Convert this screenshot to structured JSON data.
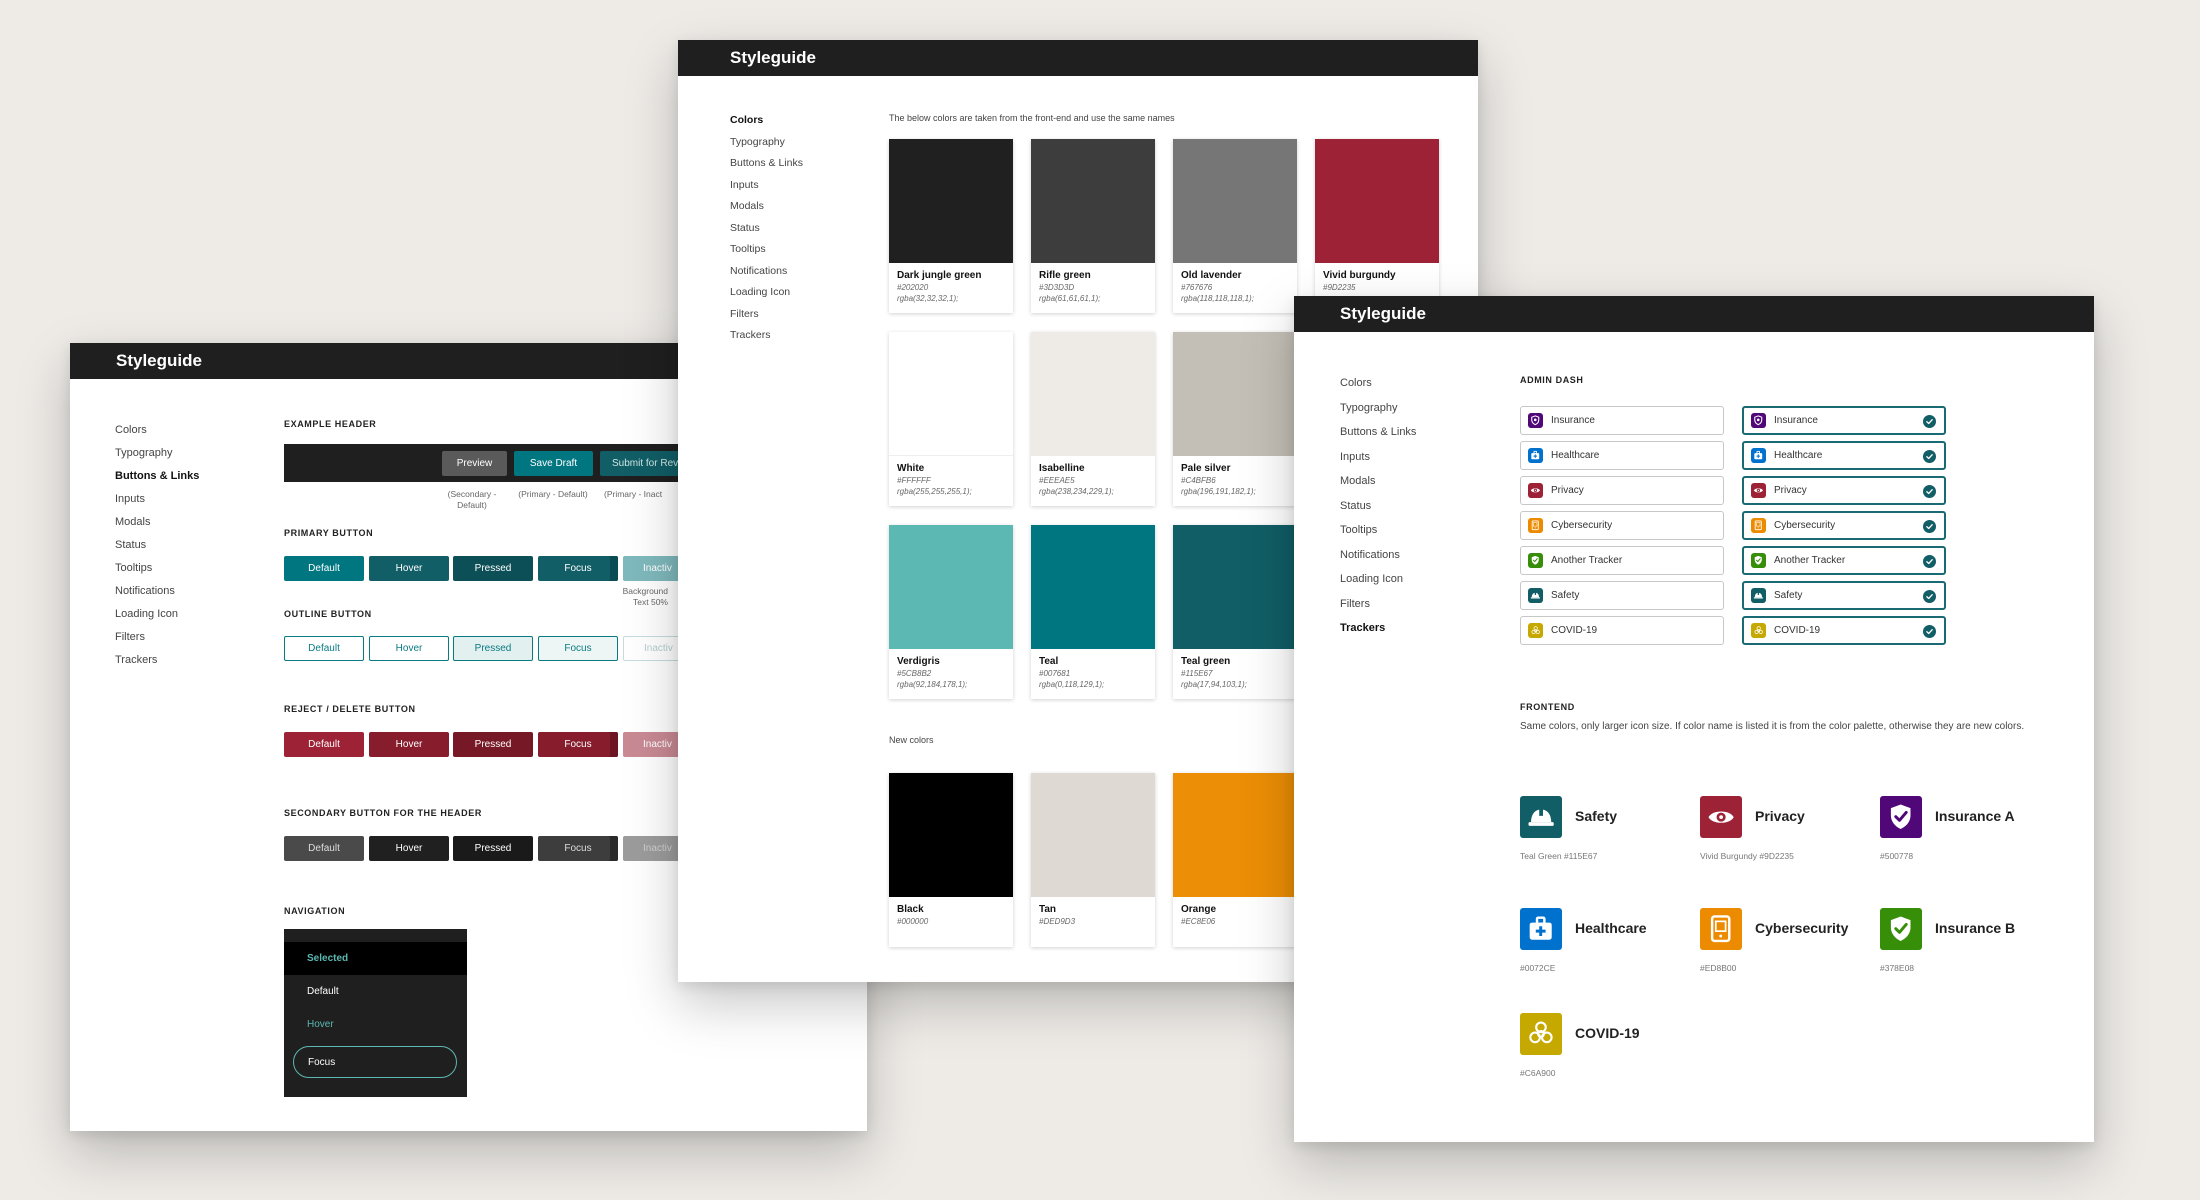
{
  "sheetA": {
    "title": "Styleguide",
    "nav": [
      "Colors",
      "Typography",
      "Buttons & Links",
      "Inputs",
      "Modals",
      "Status",
      "Tooltips",
      "Notifications",
      "Loading Icon",
      "Filters",
      "Trackers"
    ],
    "nav_active_index": 2,
    "example_header": {
      "title": "EXAMPLE HEADER",
      "buttons": [
        "Preview",
        "Save Draft",
        "Submit for Rev"
      ],
      "notes": [
        "(Secondary - Default)",
        "(Primary - Default)",
        "(Primary - Inact"
      ]
    },
    "primary": {
      "title": "PRIMARY BUTTON",
      "labels": [
        "Default",
        "Hover",
        "Pressed",
        "Focus",
        "Inactiv"
      ],
      "note": "Background Text 50%"
    },
    "outline": {
      "title": "OUTLINE BUTTON",
      "labels": [
        "Default",
        "Hover",
        "Pressed",
        "Focus",
        "Inactiv"
      ]
    },
    "reject": {
      "title": "REJECT / DELETE BUTTON",
      "labels": [
        "Default",
        "Hover",
        "Pressed",
        "Focus",
        "Inactiv"
      ]
    },
    "secondary": {
      "title": "SECONDARY BUTTON FOR THE HEADER",
      "labels": [
        "Default",
        "Hover",
        "Pressed",
        "Focus",
        "Inactiv"
      ]
    },
    "navigation": {
      "title": "NAVIGATION",
      "items": [
        "Selected",
        "Default",
        "Hover",
        "Focus"
      ]
    }
  },
  "sheetB": {
    "title": "Styleguide",
    "nav": [
      "Colors",
      "Typography",
      "Buttons & Links",
      "Inputs",
      "Modals",
      "Status",
      "Tooltips",
      "Notifications",
      "Loading Icon",
      "Filters",
      "Trackers"
    ],
    "nav_active_index": 0,
    "intro": "The below colors are taken from the front-end and use the same names",
    "swatches": [
      {
        "name": "Dark jungle green",
        "hex": "#202020",
        "rgba": "rgba(32,32,32,1);",
        "color": "#202020"
      },
      {
        "name": "Rifle green",
        "hex": "#3D3D3D",
        "rgba": "rgba(61,61,61,1);",
        "color": "#3D3D3D"
      },
      {
        "name": "Old lavender",
        "hex": "#767676",
        "rgba": "rgba(118,118,118,1);",
        "color": "#767676"
      },
      {
        "name": "Vivid burgundy",
        "hex": "#9D2235",
        "rgba": "",
        "color": "#9D2235"
      },
      {
        "name": "White",
        "hex": "#FFFFFF",
        "rgba": "rgba(255,255,255,1);",
        "color": "#FFFFFF"
      },
      {
        "name": "Isabelline",
        "hex": "#EEEAE5",
        "rgba": "rgba(238,234,229,1);",
        "color": "#EEEAE5"
      },
      {
        "name": "Pale silver",
        "hex": "#C4BFB6",
        "rgba": "rgba(196,191,182,1);",
        "color": "#C4BFB6"
      },
      {
        "name": "Verdigris",
        "hex": "#5CB8B2",
        "rgba": "rgba(92,184,178,1);",
        "color": "#5CB8B2"
      },
      {
        "name": "Teal",
        "hex": "#007681",
        "rgba": "rgba(0,118,129,1);",
        "color": "#007681"
      },
      {
        "name": "Teal green",
        "hex": "#115E67",
        "rgba": "rgba(17,94,103,1);",
        "color": "#115E67"
      }
    ],
    "new_colors_label": "New colors",
    "new_swatches": [
      {
        "name": "Black",
        "hex": "#000000",
        "color": "#000000"
      },
      {
        "name": "Tan",
        "hex": "#DED9D3",
        "color": "#DED9D3"
      },
      {
        "name": "Orange",
        "hex": "#EC8E06",
        "color": "#EC8E06"
      }
    ]
  },
  "sheetC": {
    "title": "Styleguide",
    "nav": [
      "Colors",
      "Typography",
      "Buttons & Links",
      "Inputs",
      "Modals",
      "Status",
      "Tooltips",
      "Notifications",
      "Loading Icon",
      "Filters",
      "Trackers"
    ],
    "nav_active_index": 10,
    "admin_title": "ADMIN DASH",
    "trackers": [
      {
        "label": "Insurance",
        "color": "#500778",
        "icon": "shield-icon"
      },
      {
        "label": "Healthcare",
        "color": "#0072CE",
        "icon": "medkit-icon"
      },
      {
        "label": "Privacy",
        "color": "#9D2235",
        "icon": "eye-icon"
      },
      {
        "label": "Cybersecurity",
        "color": "#ED8B00",
        "icon": "tablet-icon"
      },
      {
        "label": "Another Tracker",
        "color": "#378E08",
        "icon": "shield-check-icon"
      },
      {
        "label": "Safety",
        "color": "#115E67",
        "icon": "hardhat-icon"
      },
      {
        "label": "COVID-19",
        "color": "#C6A900",
        "icon": "biohazard-icon"
      }
    ],
    "frontend_title": "FRONTEND",
    "frontend_desc": "Same colors, only larger icon size. If color name is listed it is from the color palette, otherwise they are new colors.",
    "frontend_icons": [
      {
        "label": "Safety",
        "caption": "Teal Green #115E67",
        "color": "#115E67",
        "icon": "hardhat-icon"
      },
      {
        "label": "Privacy",
        "caption": "Vivid Burgundy #9D2235",
        "color": "#9D2235",
        "icon": "eye-icon"
      },
      {
        "label": "Insurance A",
        "caption": "#500778",
        "color": "#500778",
        "icon": "shield-check-icon"
      },
      {
        "label": "Healthcare",
        "caption": "#0072CE",
        "color": "#0072CE",
        "icon": "medkit-icon"
      },
      {
        "label": "Cybersecurity",
        "caption": "#ED8B00",
        "color": "#ED8B00",
        "icon": "tablet-icon"
      },
      {
        "label": "Insurance B",
        "caption": "#378E08",
        "color": "#378E08",
        "icon": "shield-check-icon"
      },
      {
        "label": "COVID-19",
        "caption": "#C6A900",
        "color": "#C6A900",
        "icon": "biohazard-icon"
      }
    ]
  }
}
